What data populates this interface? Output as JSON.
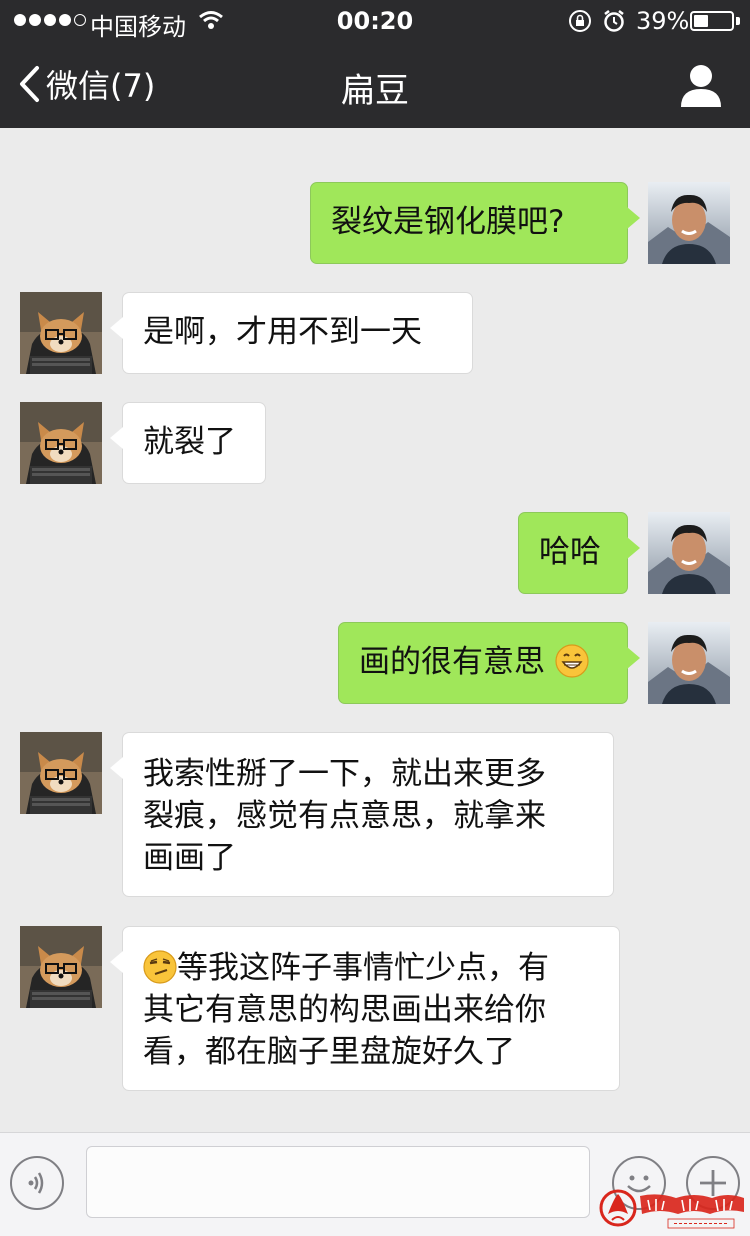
{
  "status_bar": {
    "carrier": "中国移动",
    "time": "00:20",
    "battery_percent": "39%",
    "battery_level": 0.39,
    "signal_bars": 4
  },
  "nav": {
    "back_label": "微信(7)",
    "title": "扁豆"
  },
  "messages": [
    {
      "sender": "me",
      "text": "裂纹是钢化膜吧?"
    },
    {
      "sender": "other",
      "text": "是啊，才用不到一天"
    },
    {
      "sender": "other",
      "text": "就裂了"
    },
    {
      "sender": "me",
      "text": "哈哈"
    },
    {
      "sender": "me",
      "text": "画的很有意思",
      "emoji_after": "grin-emoji"
    },
    {
      "sender": "other",
      "lines": [
        "我索性掰了一下，就出来更多",
        "裂痕，感觉有点意思，就拿来",
        "画画了"
      ]
    },
    {
      "sender": "other",
      "emoji_before": "smirk-emoji",
      "lines": [
        "等我这阵子事情忙少点，有",
        "其它有意思的构思画出来给你",
        "看，都在脑子里盘旋好久了"
      ]
    }
  ],
  "input_bar": {
    "text_value": ""
  },
  "watermark": {
    "title": "商龙电商学院",
    "tagline": "专注·专业"
  },
  "colors": {
    "header_bg": "#2b2b2d",
    "chat_bg": "#ebebeb",
    "my_bubble": "#a0e75a",
    "their_bubble": "#ffffff",
    "watermark_red": "#d9261c"
  }
}
